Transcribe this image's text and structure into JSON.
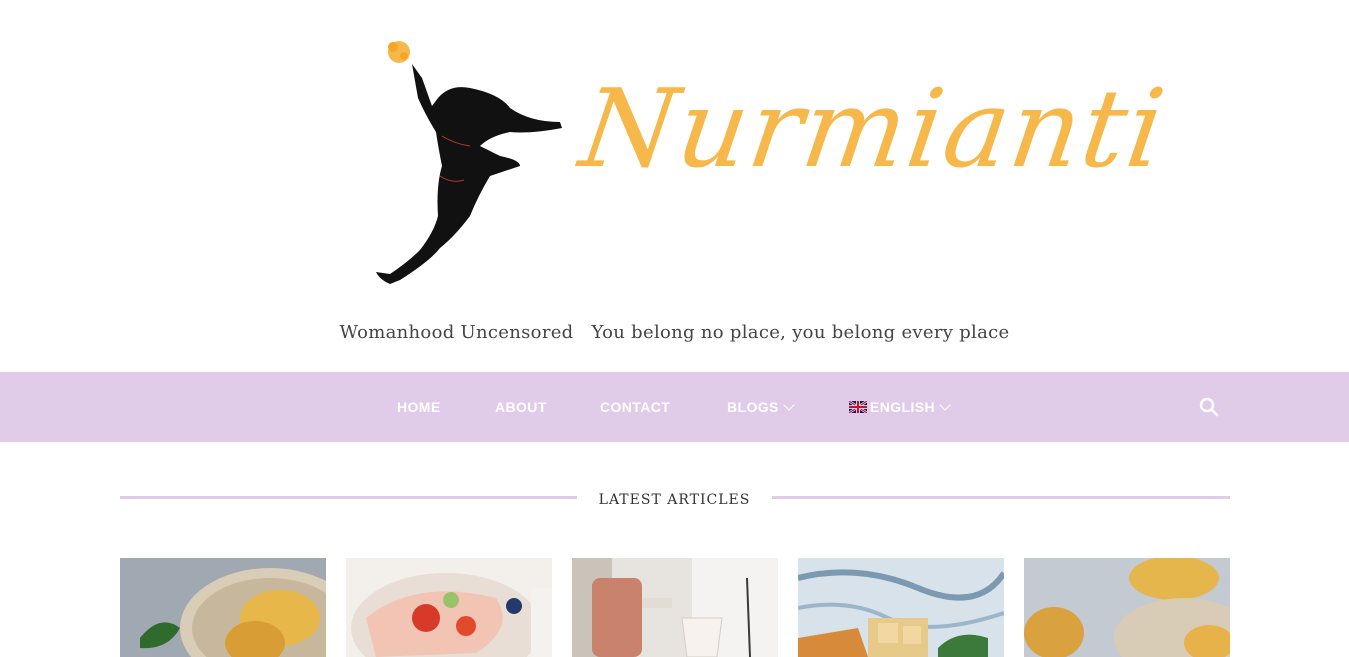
{
  "header": {
    "logo_text": "Nurmianti",
    "tagline_left": "Womanhood Uncensored",
    "tagline_right": "You belong no place, you belong every place"
  },
  "nav": {
    "items": [
      {
        "label": "HOME"
      },
      {
        "label": "ABOUT"
      },
      {
        "label": "CONTACT"
      },
      {
        "label": "BLOGS"
      },
      {
        "label": "ENGLISH"
      }
    ]
  },
  "latest": {
    "title": "LATEST ARTICLES"
  },
  "colors": {
    "accent": "#e0cce8",
    "logo": "#f7b84b",
    "nav_text": "#ffffff"
  },
  "icons": {
    "search": "search-icon",
    "flag": "uk-flag-icon",
    "chevron": "chevron-down-icon"
  }
}
